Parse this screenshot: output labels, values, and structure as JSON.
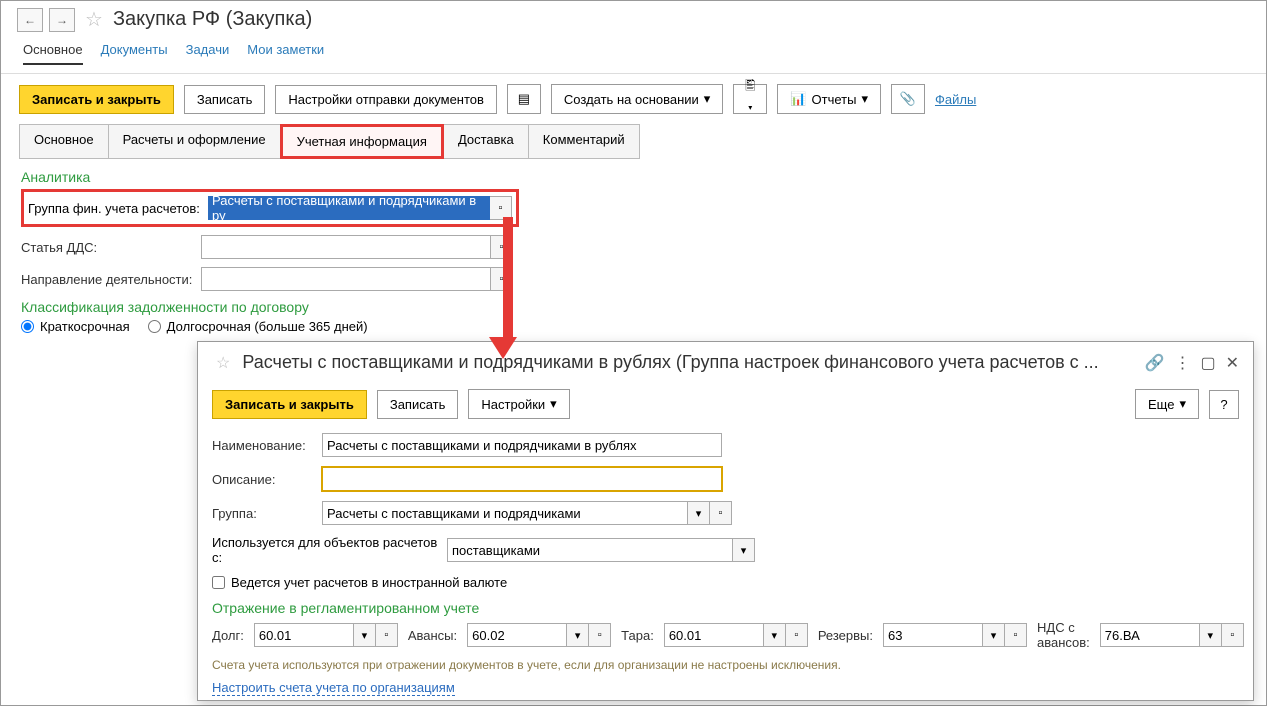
{
  "nav": {
    "title": "Закупка РФ (Закупка)"
  },
  "tabs": {
    "main": "Основное",
    "docs": "Документы",
    "tasks": "Задачи",
    "notes": "Мои заметки"
  },
  "toolbar": {
    "save_close": "Записать и закрыть",
    "save": "Записать",
    "settings_send": "Настройки отправки документов",
    "create_based": "Создать на основании",
    "reports": "Отчеты",
    "files": "Файлы"
  },
  "subtabs": {
    "main": "Основное",
    "calc": "Расчеты и оформление",
    "acct": "Учетная информация",
    "delivery": "Доставка",
    "comment": "Комментарий"
  },
  "analytics": {
    "title": "Аналитика",
    "group_label": "Группа фин. учета расчетов:",
    "group_value": "Расчеты с поставщиками и подрядчиками в ру",
    "dds_label": "Статья ДДС:",
    "direction_label": "Направление деятельности:"
  },
  "classification": {
    "title": "Классификация задолженности по договору",
    "short": "Краткосрочная",
    "long": "Долгосрочная (больше 365 дней)"
  },
  "popup": {
    "title": "Расчеты с поставщиками и подрядчиками в рублях (Группа настроек финансового учета расчетов с ...",
    "save_close": "Записать и закрыть",
    "save": "Записать",
    "settings": "Настройки",
    "more": "Еще",
    "help": "?",
    "name_label": "Наименование:",
    "name_value": "Расчеты с поставщиками и подрядчиками в рублях",
    "desc_label": "Описание:",
    "group_label": "Группа:",
    "group_value": "Расчеты с поставщиками и подрядчиками",
    "used_for_label": "Используется для объектов расчетов с:",
    "used_for_value": "поставщиками",
    "foreign_currency": "Ведется учет расчетов в иностранной валюте",
    "regl_title": "Отражение в регламентированном учете",
    "debt_label": "Долг:",
    "debt_value": "60.01",
    "advance_label": "Авансы:",
    "advance_value": "60.02",
    "tare_label": "Тара:",
    "tare_value": "60.01",
    "reserve_label": "Резервы:",
    "reserve_value": "63",
    "vat_label": "НДС с авансов:",
    "vat_value": "76.ВА",
    "hint": "Счета учета используются при отражении документов в учете, если для организации не настроены исключения.",
    "conf_link": "Настроить счета учета по организациям"
  }
}
